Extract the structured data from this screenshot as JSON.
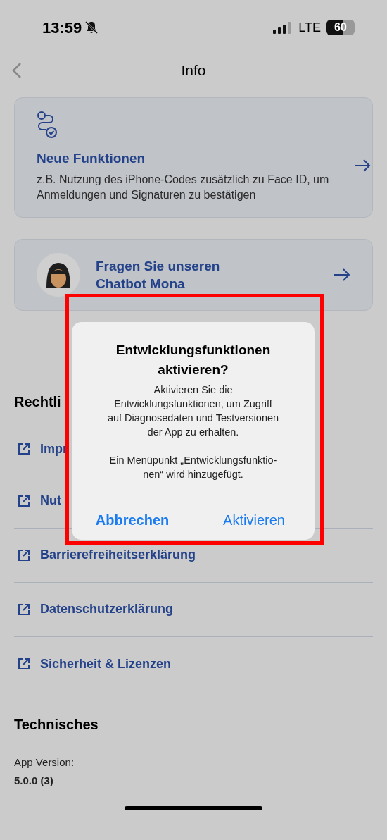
{
  "status_bar": {
    "time": "13:59",
    "network": "LTE",
    "battery": "60"
  },
  "header": {
    "title": "Info"
  },
  "cards": [
    {
      "kind": "feature",
      "title": "Neue Funktionen",
      "description": "z.B. Nutzung des iPhone-Codes zusätzlich zu Face ID, um Anmeldungen und Signaturen zu bestätigen"
    },
    {
      "kind": "chatbot",
      "title": "Fragen Sie unseren\nChatbot Mona"
    }
  ],
  "legal": {
    "heading": "Rechtli",
    "links": [
      "Impr",
      "Nut",
      "Barrierefreiheitserklärung",
      "Datenschutzerklärung",
      "Sicherheit & Lizenzen"
    ]
  },
  "technical": {
    "heading": "Technisches",
    "label": "App Version:",
    "value": "5.0.0 (3)"
  },
  "dialog": {
    "title": "Entwicklungsfunktionen aktivieren?",
    "paragraphs": [
      "Aktivieren Sie die\nEntwicklungsfunktionen, um Zugriff\nauf Diagnosedaten und Testversionen\nder App zu erhalten.",
      "Ein Menüpunkt „Entwicklungsfunktio-\nnen“ wird hinzugefügt."
    ],
    "buttons": [
      {
        "label": "Abbrechen",
        "kind": "cancel"
      },
      {
        "label": "Aktivieren",
        "kind": "default"
      }
    ]
  }
}
